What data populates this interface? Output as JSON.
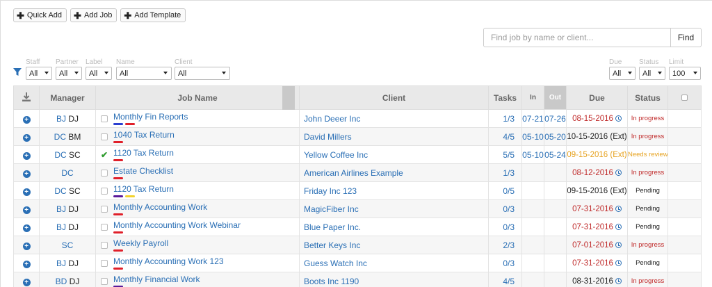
{
  "toolbar": {
    "quick_add": "Quick Add",
    "add_job": "Add Job",
    "add_template": "Add Template"
  },
  "search": {
    "placeholder": "Find job by name or client...",
    "button": "Find"
  },
  "filters": {
    "staff": {
      "label": "Staff",
      "value": "All"
    },
    "partner": {
      "label": "Partner",
      "value": "All"
    },
    "label": {
      "label": "Label",
      "value": "All"
    },
    "name": {
      "label": "Name",
      "value": "All"
    },
    "client": {
      "label": "Client",
      "value": "All"
    },
    "due": {
      "label": "Due",
      "value": "All"
    },
    "status": {
      "label": "Status",
      "value": "All"
    },
    "limit": {
      "label": "Limit",
      "value": "100"
    }
  },
  "table": {
    "headers": {
      "manager": "Manager",
      "job_name": "Job Name",
      "client": "Client",
      "tasks": "Tasks",
      "in": "In",
      "out": "Out",
      "due": "Due",
      "status": "Status"
    },
    "rows": [
      {
        "m1": "BJ",
        "m2": "DJ",
        "check": "box",
        "job": "Monthly Fin Reports",
        "labels": [
          "#2b3fd0",
          "#e0202a"
        ],
        "client": "John Deeer Inc",
        "tasks": "1/3",
        "in": "07-21",
        "out": "07-26",
        "due": "08-15-2016",
        "due_color": "red",
        "clock": true,
        "status": "In progress",
        "status_color": "red"
      },
      {
        "m1": "DC",
        "m2": "BM",
        "check": "box",
        "job": "1040 Tax Return",
        "labels": [
          "#e0202a"
        ],
        "client": "David Millers",
        "tasks": "4/5",
        "in": "05-10",
        "out": "05-20",
        "due": "10-15-2016 (Ext)",
        "due_color": "black",
        "clock": false,
        "status": "In progress",
        "status_color": "red"
      },
      {
        "m1": "DC",
        "m2": "SC",
        "check": "tick",
        "job": "1120 Tax Return",
        "labels": [
          "#e0202a"
        ],
        "client": "Yellow Coffee Inc",
        "tasks": "5/5",
        "in": "05-10",
        "out": "05-24",
        "due": "09-15-2016 (Ext)",
        "due_color": "orange",
        "clock": false,
        "status": "Needs review",
        "status_color": "orange"
      },
      {
        "m1": "DC",
        "m2": "",
        "check": "box",
        "job": "Estate Checklist",
        "labels": [
          "#e0202a"
        ],
        "client": "American Airlines Example",
        "tasks": "1/3",
        "in": "",
        "out": "",
        "due": "08-12-2016",
        "due_color": "red",
        "clock": true,
        "status": "In progress",
        "status_color": "red"
      },
      {
        "m1": "DC",
        "m2": "SC",
        "check": "box",
        "job": "1120 Tax Return",
        "labels": [
          "#5a1a9a",
          "#f2d22e"
        ],
        "client": "Friday Inc 123",
        "tasks": "0/5",
        "in": "",
        "out": "",
        "due": "09-15-2016 (Ext)",
        "due_color": "black",
        "clock": false,
        "status": "Pending",
        "status_color": "black"
      },
      {
        "m1": "BJ",
        "m2": "DJ",
        "check": "box",
        "job": "Monthly Accounting Work",
        "labels": [
          "#e0202a"
        ],
        "client": "MagicFiber Inc",
        "tasks": "0/3",
        "in": "",
        "out": "",
        "due": "07-31-2016",
        "due_color": "red",
        "clock": true,
        "status": "Pending",
        "status_color": "black"
      },
      {
        "m1": "BJ",
        "m2": "DJ",
        "check": "box",
        "job": "Monthly Accounting Work Webinar",
        "labels": [
          "#e0202a"
        ],
        "client": "Blue Paper Inc.",
        "tasks": "0/3",
        "in": "",
        "out": "",
        "due": "07-31-2016",
        "due_color": "red",
        "clock": true,
        "status": "Pending",
        "status_color": "black"
      },
      {
        "m1": "SC",
        "m2": "",
        "check": "box",
        "job": "Weekly Payroll",
        "labels": [
          "#e0202a"
        ],
        "client": "Better Keys Inc",
        "tasks": "2/3",
        "in": "",
        "out": "",
        "due": "07-01-2016",
        "due_color": "red",
        "clock": true,
        "status": "In progress",
        "status_color": "red"
      },
      {
        "m1": "BJ",
        "m2": "DJ",
        "check": "box",
        "job": "Monthly Accounting Work 123",
        "labels": [
          "#e0202a"
        ],
        "client": "Guess Watch Inc",
        "tasks": "0/3",
        "in": "",
        "out": "",
        "due": "07-31-2016",
        "due_color": "red",
        "clock": true,
        "status": "Pending",
        "status_color": "black"
      },
      {
        "m1": "BD",
        "m2": "DJ",
        "check": "box",
        "job": "Monthly Financial Work",
        "labels": [
          "#5a1a9a"
        ],
        "client": "Boots Inc 1190",
        "tasks": "4/5",
        "in": "",
        "out": "",
        "due": "08-31-2016",
        "due_color": "black",
        "clock": true,
        "status": "In progress",
        "status_color": "red"
      }
    ]
  }
}
